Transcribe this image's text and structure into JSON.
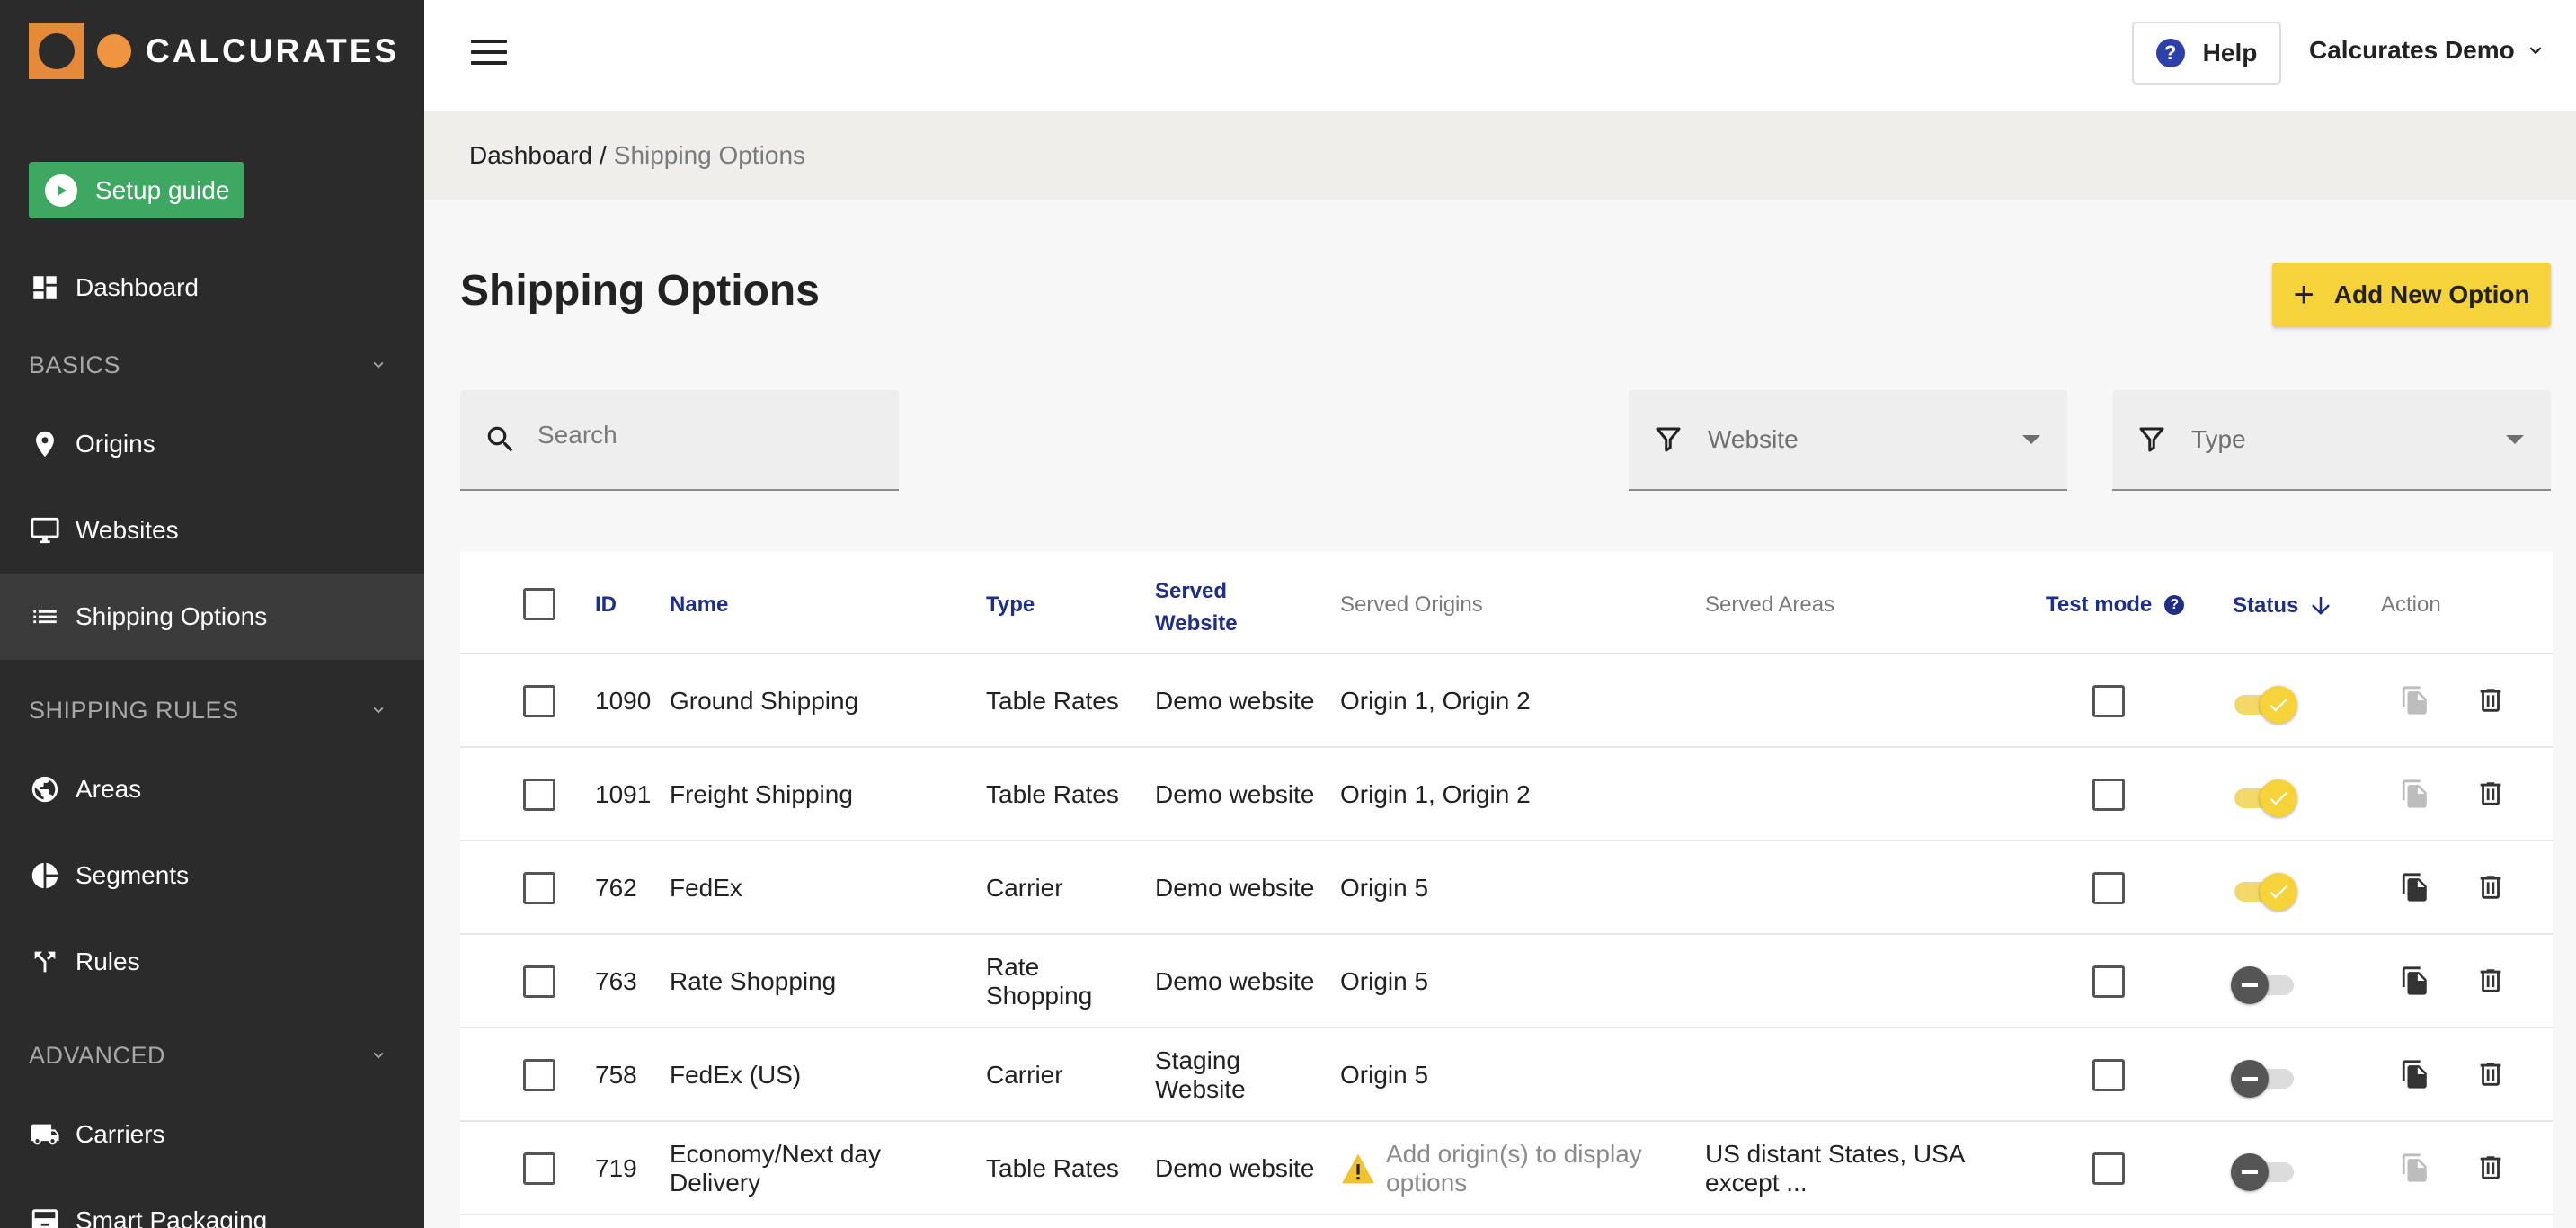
{
  "brand": {
    "name": "CALCURATES"
  },
  "colors": {
    "sidebar_bg": "#2b2b2b",
    "accent_yellow": "#f6d33b",
    "setup_green": "#3ea863",
    "link_blue": "#1f2e86",
    "logo_orange": "#e58a3a"
  },
  "sidebar": {
    "setup_guide": "Setup guide",
    "dashboard": "Dashboard",
    "section_basics": "BASICS",
    "origins": "Origins",
    "websites": "Websites",
    "shipping_options": "Shipping Options",
    "section_shipping_rules": "SHIPPING RULES",
    "areas": "Areas",
    "segments": "Segments",
    "rules": "Rules",
    "section_advanced": "ADVANCED",
    "carriers": "Carriers",
    "smart_packaging": "Smart Packaging"
  },
  "topbar": {
    "help": "Help",
    "account": "Calcurates Demo"
  },
  "breadcrumb": {
    "root": "Dashboard",
    "separator": "/",
    "current": "Shipping Options"
  },
  "page": {
    "title": "Shipping Options",
    "add_button": "Add New Option"
  },
  "filters": {
    "search_placeholder": "Search",
    "website": "Website",
    "type": "Type"
  },
  "table": {
    "headers": {
      "id": "ID",
      "name": "Name",
      "type": "Type",
      "served_website_1": "Served",
      "served_website_2": "Website",
      "served_origins": "Served Origins",
      "served_areas": "Served Areas",
      "test_mode": "Test mode",
      "status": "Status",
      "action": "Action"
    },
    "rows": [
      {
        "id": "1090",
        "name": "Ground Shipping",
        "name2": "",
        "type": "Table Rates",
        "type2": "",
        "website": "Demo website",
        "website2": "",
        "origins": "Origin 1, Origin 2",
        "origins_warning": false,
        "areas": "",
        "areas2": "",
        "status_on": true,
        "copy_enabled": false
      },
      {
        "id": "1091",
        "name": "Freight Shipping",
        "name2": "",
        "type": "Table Rates",
        "type2": "",
        "website": "Demo website",
        "website2": "",
        "origins": "Origin 1, Origin 2",
        "origins_warning": false,
        "areas": "",
        "areas2": "",
        "status_on": true,
        "copy_enabled": false
      },
      {
        "id": "762",
        "name": "FedEx",
        "name2": "",
        "type": "Carrier",
        "type2": "",
        "website": "Demo website",
        "website2": "",
        "origins": "Origin 5",
        "origins_warning": false,
        "areas": "",
        "areas2": "",
        "status_on": true,
        "copy_enabled": true
      },
      {
        "id": "763",
        "name": "Rate Shopping",
        "name2": "",
        "type": "Rate",
        "type2": "Shopping",
        "website": "Demo website",
        "website2": "",
        "origins": "Origin 5",
        "origins_warning": false,
        "areas": "",
        "areas2": "",
        "status_on": false,
        "copy_enabled": true
      },
      {
        "id": "758",
        "name": "FedEx (US)",
        "name2": "",
        "type": "Carrier",
        "type2": "",
        "website": "Staging",
        "website2": "Website",
        "origins": "Origin 5",
        "origins_warning": false,
        "areas": "",
        "areas2": "",
        "status_on": false,
        "copy_enabled": true
      },
      {
        "id": "719",
        "name": "Economy/Next day",
        "name2": "Delivery",
        "type": "Table Rates",
        "type2": "",
        "website": "Demo website",
        "website2": "",
        "origins": "Add origin(s) to display",
        "origins2": "options",
        "origins_warning": true,
        "areas": "US distant States, USA",
        "areas2": "except ...",
        "status_on": false,
        "copy_enabled": false
      }
    ]
  }
}
